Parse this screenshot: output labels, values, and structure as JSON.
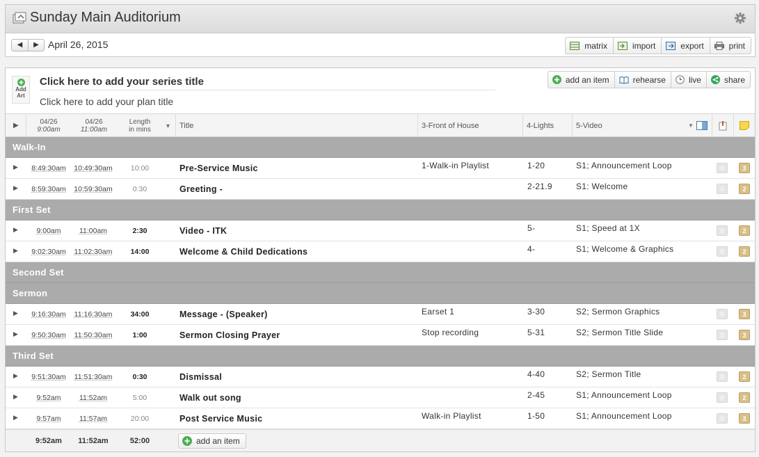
{
  "header": {
    "title": "Sunday Main Auditorium"
  },
  "datebar": {
    "prev": "◀",
    "next": "▶",
    "date": "April 26, 2015",
    "tools": [
      {
        "label": "matrix"
      },
      {
        "label": "import"
      },
      {
        "label": "export"
      },
      {
        "label": "print"
      }
    ]
  },
  "plan": {
    "add_art": [
      "Add",
      "Art"
    ],
    "series_title": "Click here to add your series title",
    "plan_title": "Click here to add your plan title",
    "actions": [
      {
        "label": "add an item"
      },
      {
        "label": "rehearse"
      },
      {
        "label": "live"
      },
      {
        "label": "share"
      }
    ]
  },
  "columns": {
    "time1_date": "04/26",
    "time1_time": "9:00am",
    "time2_date": "04/26",
    "time2_time": "11:00am",
    "length_1": "Length",
    "length_2": "in mins",
    "title": "Title",
    "foh": "3-Front of House",
    "lights": "4-Lights",
    "video": "5-Video"
  },
  "rows": [
    {
      "type": "section",
      "label": "Walk-In"
    },
    {
      "type": "item",
      "t1": "8:49:30am",
      "t2": "10:49:30am",
      "len": "10:00",
      "bold": false,
      "title": "Pre-Service Music",
      "foh": "1-Walk-in Playlist",
      "lights": "1-20",
      "video": "S1; Announcement Loop",
      "att": "0",
      "notes": "3"
    },
    {
      "type": "item",
      "t1": "8:59:30am",
      "t2": "10:59:30am",
      "len": "0:30",
      "bold": false,
      "title": "Greeting -",
      "foh": "",
      "lights": "2-21.9",
      "video": "S1: Welcome",
      "att": "0",
      "notes": "2"
    },
    {
      "type": "section",
      "label": "First Set"
    },
    {
      "type": "item",
      "t1": "9:00am",
      "t2": "11:00am",
      "len": "2:30",
      "bold": true,
      "title": "Video - ITK",
      "foh": "",
      "lights": "5-",
      "video": "S1; Speed at 1X",
      "att": "0",
      "notes": "2"
    },
    {
      "type": "item",
      "t1": "9:02:30am",
      "t2": "11:02:30am",
      "len": "14:00",
      "bold": true,
      "title": "Welcome & Child Dedications",
      "foh": "",
      "lights": "4-",
      "video": "S1; Welcome & Graphics",
      "att": "0",
      "notes": "2"
    },
    {
      "type": "section",
      "label": "Second Set"
    },
    {
      "type": "section",
      "label": "Sermon"
    },
    {
      "type": "item",
      "t1": "9:16:30am",
      "t2": "11:16:30am",
      "len": "34:00",
      "bold": true,
      "title": "Message - (Speaker)",
      "foh": "Earset 1",
      "lights": "3-30",
      "video": "S2; Sermon Graphics",
      "att": "0",
      "notes": "3"
    },
    {
      "type": "item",
      "t1": "9:50:30am",
      "t2": "11:50:30am",
      "len": "1:00",
      "bold": true,
      "title": "Sermon Closing Prayer",
      "foh": "Stop recording",
      "lights": "5-31",
      "video": "S2; Sermon Title Slide",
      "att": "0",
      "notes": "3"
    },
    {
      "type": "section",
      "label": "Third Set"
    },
    {
      "type": "item",
      "t1": "9:51:30am",
      "t2": "11:51:30am",
      "len": "0:30",
      "bold": true,
      "title": "Dismissal",
      "foh": "",
      "lights": "4-40",
      "video": "S2; Sermon Title",
      "att": "0",
      "notes": "2"
    },
    {
      "type": "item",
      "t1": "9:52am",
      "t2": "11:52am",
      "len": "5:00",
      "bold": false,
      "title": "Walk out song",
      "foh": "",
      "lights": "2-45",
      "video": "S1; Announcement Loop",
      "att": "0",
      "notes": "2"
    },
    {
      "type": "item",
      "t1": "9:57am",
      "t2": "11:57am",
      "len": "20:00",
      "bold": false,
      "title": "Post Service Music",
      "foh": "Walk-in Playlist",
      "lights": "1-50",
      "video": "S1; Announcement Loop",
      "att": "0",
      "notes": "3"
    }
  ],
  "footer": {
    "t1": "9:52am",
    "t2": "11:52am",
    "len": "52:00",
    "add_label": "add an item"
  },
  "colors": {
    "section_bg": "#ababab",
    "note_badge": "#d9c08a",
    "accent_green": "#4caf50"
  }
}
